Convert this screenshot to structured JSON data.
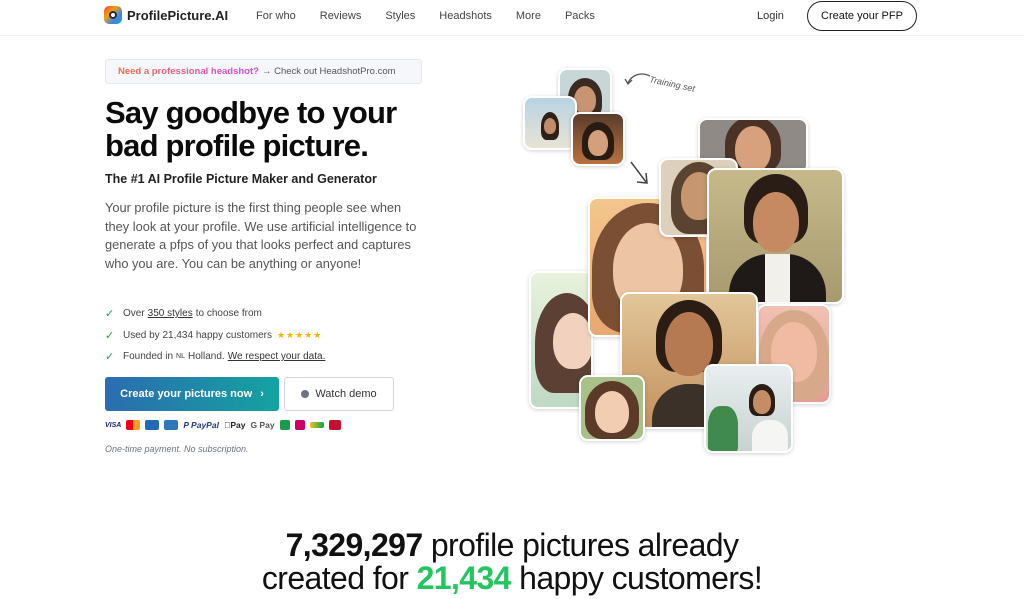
{
  "brand": {
    "name": "ProfilePicture.AI"
  },
  "nav": {
    "items": [
      "For who",
      "Reviews",
      "Styles",
      "Headshots",
      "More",
      "Packs"
    ],
    "login": "Login",
    "cta": "Create your PFP"
  },
  "announcement": {
    "strong": "Need a professional headshot?",
    "rest": "→ Check out HeadshotPro.com"
  },
  "hero": {
    "headline": "Say goodbye to your bad profile picture.",
    "subheadline": "The #1 AI Profile Picture Maker and Generator",
    "description": "Your profile picture is the first thing people see when they look at your profile. We use artificial intelligence to generate a pfps of you that looks perfect and captures who you are. You can be anything or anyone!"
  },
  "checks": {
    "styles_prefix": "Over",
    "styles_link": "350 styles",
    "styles_suffix": "to choose from",
    "customers": "Used by 21,434 happy customers",
    "stars": "★★★★★",
    "founded_prefix": "Founded in",
    "founded_flag": "NL",
    "founded_country": "Holland.",
    "data_link": "We respect your data."
  },
  "buttons": {
    "primary": "Create your pictures now",
    "primary_arrow": "›",
    "secondary": "Watch demo"
  },
  "payments": [
    "VISA",
    "P PayPal",
    "Pay",
    "G Pay"
  ],
  "payment_note": "One-time payment. No subscription.",
  "collage": {
    "training_label": "Training set"
  },
  "stats": {
    "count": "7,329,297",
    "line1_rest": "profile pictures already",
    "line2_prefix": "created for",
    "customers": "21,434",
    "line2_suffix": "happy customers!"
  },
  "colors": {
    "accent_gradient_start": "#2b6cb0",
    "accent_gradient_end": "#14a3a0",
    "green": "#22c55e",
    "check_green": "#16a34a",
    "star": "#f5b301"
  }
}
